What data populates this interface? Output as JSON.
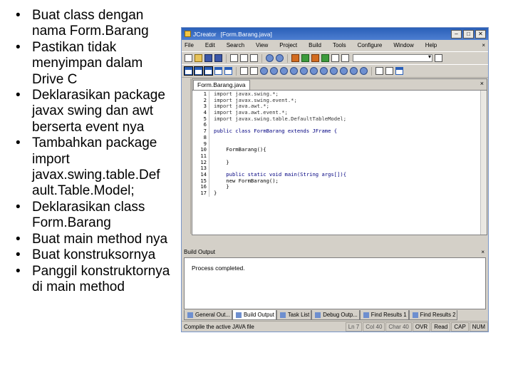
{
  "bullets": [
    "Buat class dengan nama Form.Barang",
    "Pastikan tidak menyimpan dalam Drive C",
    "Deklarasikan package javax swing dan awt berserta event nya",
    "Tambahkan package import javax.swing.table.Def ault.Table.Model;",
    "Deklarasikan class Form.Barang",
    "Buat main method nya",
    "Buat konstruksornya",
    "Panggil konstruktornya di main method"
  ],
  "window": {
    "title": "JCreator",
    "document": "[Form.Barang.java]",
    "buttons": {
      "minimize": "–",
      "maximize": "□",
      "close": "✕"
    },
    "colors": {
      "titlebar": "#2a5fb8",
      "chrome": "#d4d0c8"
    }
  },
  "menu": [
    "File",
    "Edit",
    "Search",
    "View",
    "Project",
    "Build",
    "Tools",
    "Configure",
    "Window",
    "Help"
  ],
  "menu_close": "×",
  "editor": {
    "tab": "Form.Barang.java",
    "close": "×",
    "lines": [
      {
        "n": "1",
        "t": "import javax.swing.*;"
      },
      {
        "n": "2",
        "t": "import javax.swing.event.*;"
      },
      {
        "n": "3",
        "t": "import java.awt.*;"
      },
      {
        "n": "4",
        "t": "import java.awt.event.*;"
      },
      {
        "n": "5",
        "t": "import javax.swing.table.DefaultTableModel;"
      },
      {
        "n": "6",
        "t": ""
      },
      {
        "n": "7",
        "t": "public class FormBarang extends JFrame {"
      },
      {
        "n": "8",
        "t": ""
      },
      {
        "n": "9",
        "t": ""
      },
      {
        "n": "10",
        "t": "    FormBarang(){"
      },
      {
        "n": "11",
        "t": ""
      },
      {
        "n": "12",
        "t": "    }"
      },
      {
        "n": "13",
        "t": ""
      },
      {
        "n": "14",
        "t": "    public static void main(String args[]){"
      },
      {
        "n": "15",
        "t": "    new FormBarang();"
      },
      {
        "n": "16",
        "t": "    }"
      },
      {
        "n": "17",
        "t": "}"
      }
    ]
  },
  "output": {
    "title": "Build Output",
    "close": "×",
    "text": "Process completed.",
    "tabs": [
      "General Out...",
      "Build Output",
      "Task List",
      "Debug Outp...",
      "Find Results 1",
      "Find Results 2"
    ]
  },
  "status": {
    "message": "Compile the active JAVA file",
    "ln": "Ln 7",
    "col": "Col 40",
    "char": "Char 40",
    "cells": [
      "OVR",
      "Read",
      "CAP",
      "NUM"
    ]
  }
}
